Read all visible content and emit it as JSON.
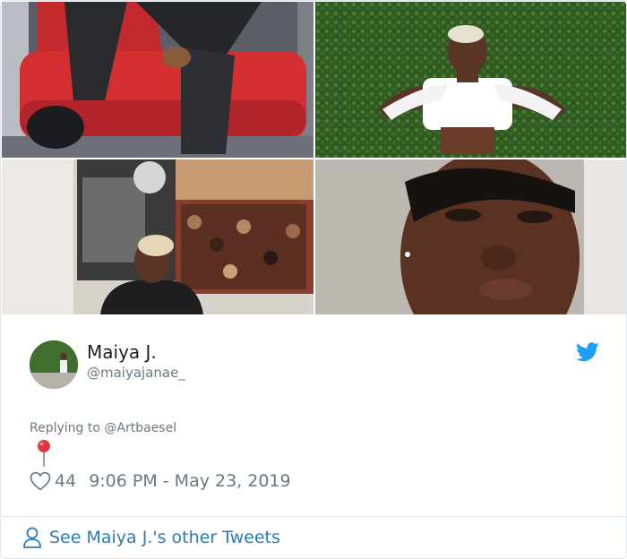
{
  "tweet": {
    "author_name": "Maiya J.",
    "author_handle": "@maiyajanae_",
    "reply_prefix": "Replying to",
    "reply_to": "@Artbaesel",
    "body_emoji_icon": "round-pushpin-icon",
    "like_count": "44",
    "timestamp": "9:06 PM - May 23, 2019"
  },
  "footer": {
    "link_label": "See Maiya J.'s other Tweets"
  },
  "icons": {
    "brand": "twitter-bird-icon",
    "like": "heart-icon",
    "profile": "person-icon"
  },
  "colors": {
    "link": "#2b7bb9",
    "secondary_text": "#697882",
    "primary_text": "#1c2022",
    "twitter_blue": "#1da1f2",
    "border": "#e1e8ed"
  },
  "media": {
    "count": 4
  }
}
